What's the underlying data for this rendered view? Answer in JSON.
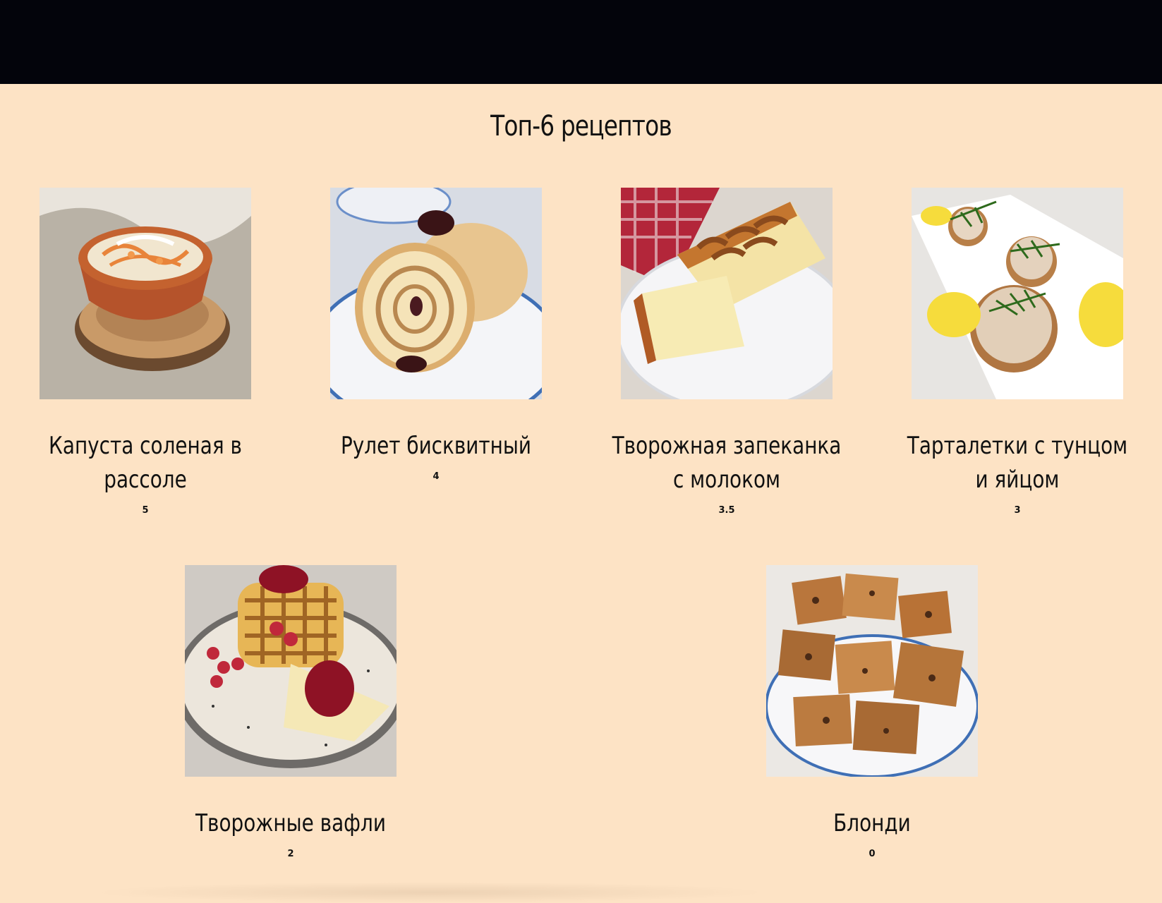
{
  "section": {
    "title": "Топ-6 рецептов"
  },
  "recipes": [
    {
      "name": "Капуста соленая в рассоле",
      "rating": "5",
      "image_alt": "sauerkraut-photo"
    },
    {
      "name": "Рулет бисквитный",
      "rating": "4",
      "image_alt": "sponge-roll-photo"
    },
    {
      "name": "Творожная запеканка с молоком",
      "rating": "3.5",
      "image_alt": "cottage-cheese-casserole-photo"
    },
    {
      "name": "Тарталетки с тунцом и яйцом",
      "rating": "3",
      "image_alt": "tartlets-tuna-egg-photo"
    },
    {
      "name": "Творожные вафли",
      "rating": "2",
      "image_alt": "cottage-cheese-waffles-photo"
    },
    {
      "name": "Блонди",
      "rating": "0",
      "image_alt": "blondie-photo"
    }
  ],
  "colors": {
    "page_background": "#fde3c5",
    "top_bar": "#03040b",
    "text": "#111111"
  }
}
